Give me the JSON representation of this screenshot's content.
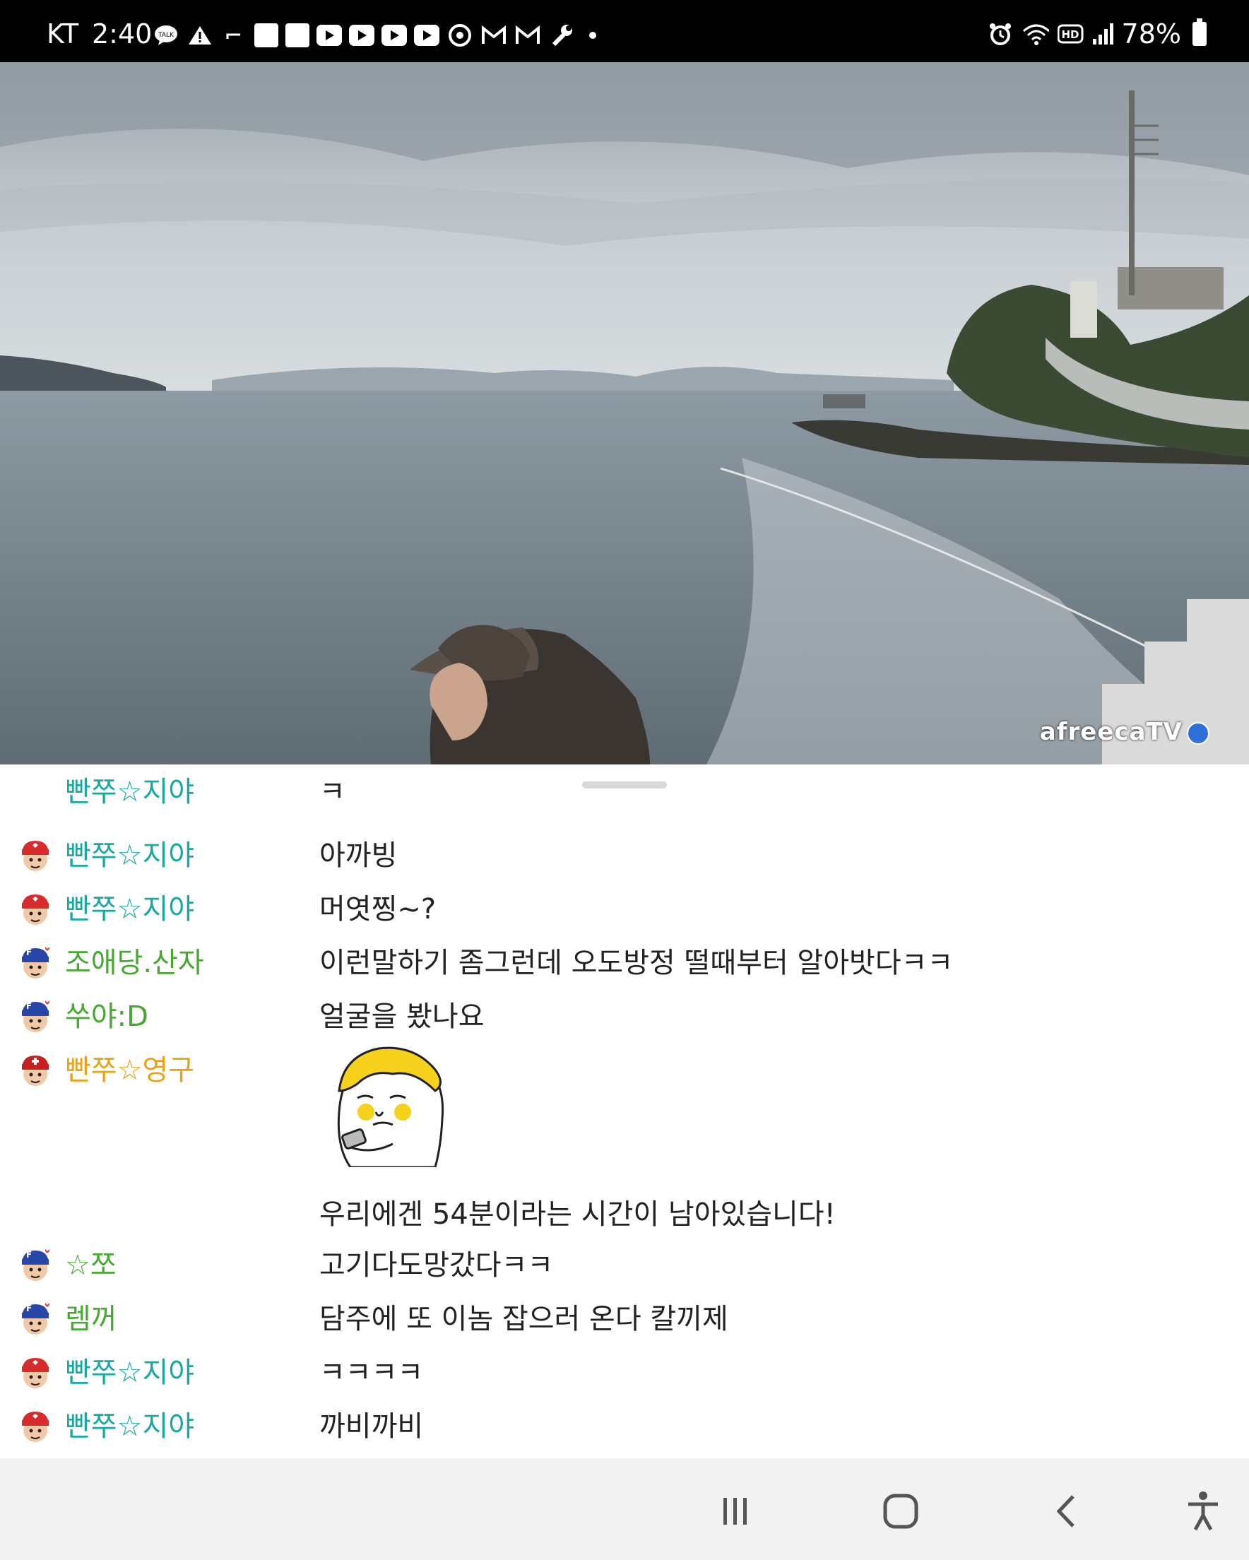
{
  "status_bar": {
    "carrier": "KT",
    "time": "2:40",
    "battery": "78%",
    "notification_icons": [
      "talk-icon",
      "warning-icon",
      "bracket-icon",
      "kia-connect-icon",
      "kia-connect-icon",
      "youtube-icon",
      "youtube-icon",
      "youtube-icon",
      "youtube-icon",
      "chrome-icon",
      "gmail-icon",
      "gmail-icon",
      "wrench-icon",
      "dot-icon"
    ],
    "system_icons": [
      "alarm-icon",
      "wifi-icon",
      "hd-icon",
      "signal-icon",
      "battery-icon"
    ]
  },
  "video": {
    "watermark": "afreecaTV"
  },
  "chat": {
    "partial_row": {
      "nick": "빤쭈☆지야",
      "message": "ㅋ"
    },
    "messages": [
      {
        "nick": "빤쭈☆지야",
        "message": "아까빙",
        "nick_color": "#1aa9a0",
        "badge": "heart"
      },
      {
        "nick": "빤쭈☆지야",
        "message": "머엿찡~?",
        "nick_color": "#1aa9a0",
        "badge": "heart"
      },
      {
        "nick": "조애당.산자",
        "message": "이런말하기 좀그런데 오도방정 떨때부터 알아밧다ㅋㅋ",
        "nick_color": "#49a834",
        "badge": "fan"
      },
      {
        "nick": "쑤야:D",
        "message": "얼굴을 봤나요",
        "nick_color": "#49a834",
        "badge": "fan"
      },
      {
        "nick": "빤쭈☆영구",
        "message": "",
        "nick_color": "#e8a317",
        "badge": "manager"
      },
      {
        "nick": "☆쪼",
        "message": "고기다도망갔다ㅋㅋ",
        "nick_color": "#49a834",
        "badge": "fan"
      },
      {
        "nick": "렘꺼",
        "message": "담주에 또 이놈 잡으러 온다 칼끼제",
        "nick_color": "#49a834",
        "badge": "fan"
      },
      {
        "nick": "빤쭈☆지야",
        "message": "ㅋㅋㅋㅋ",
        "nick_color": "#1aa9a0",
        "badge": "heart"
      },
      {
        "nick": "빤쭈☆지야",
        "message": "까비까비",
        "nick_color": "#1aa9a0",
        "badge": "heart"
      }
    ],
    "system_message": "우리에겐 54분이라는 시간이 남아있습니다!"
  },
  "nav_bar": {
    "buttons": [
      "recent-apps-icon",
      "home-icon",
      "back-icon",
      "accessibility-icon"
    ]
  }
}
